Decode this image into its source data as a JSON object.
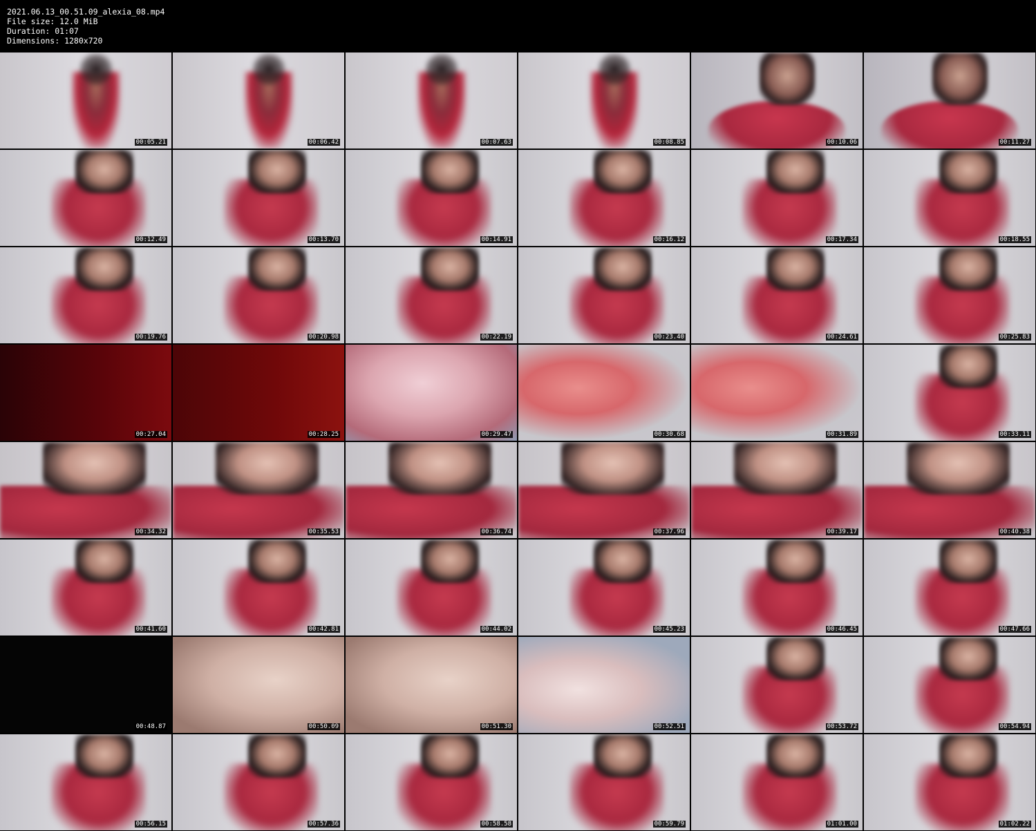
{
  "header": {
    "filename": "2021.06.13_00.51.09_alexia_08.mp4",
    "file_size": "File size: 12.0 MiB",
    "duration": "Duration: 01:07",
    "dimensions": "Dimensions: 1280x720"
  },
  "thumbnails": [
    {
      "time": "00:05.21",
      "scene": "s-wall s-person"
    },
    {
      "time": "00:06.42",
      "scene": "s-wall s-person"
    },
    {
      "time": "00:07.63",
      "scene": "s-wall s-person"
    },
    {
      "time": "00:08.85",
      "scene": "s-wall s-person"
    },
    {
      "time": "00:10.06",
      "scene": "s-close"
    },
    {
      "time": "00:11.27",
      "scene": "s-close"
    },
    {
      "time": "00:12.49",
      "scene": "s-room"
    },
    {
      "time": "00:13.70",
      "scene": "s-room"
    },
    {
      "time": "00:14.91",
      "scene": "s-room"
    },
    {
      "time": "00:16.12",
      "scene": "s-room"
    },
    {
      "time": "00:17.34",
      "scene": "s-room"
    },
    {
      "time": "00:18.55",
      "scene": "s-room"
    },
    {
      "time": "00:19.76",
      "scene": "s-room"
    },
    {
      "time": "00:20.98",
      "scene": "s-room"
    },
    {
      "time": "00:22.19",
      "scene": "s-room"
    },
    {
      "time": "00:23.40",
      "scene": "s-room"
    },
    {
      "time": "00:24.61",
      "scene": "s-room"
    },
    {
      "time": "00:25.83",
      "scene": "s-room"
    },
    {
      "time": "00:27.04",
      "scene": "s-red1"
    },
    {
      "time": "00:28.25",
      "scene": "s-red2"
    },
    {
      "time": "00:29.47",
      "scene": "s-finger"
    },
    {
      "time": "00:30.68",
      "scene": "s-finger2"
    },
    {
      "time": "00:31.89",
      "scene": "s-finger2"
    },
    {
      "time": "00:33.11",
      "scene": "s-room"
    },
    {
      "time": "00:34.32",
      "scene": "s-lips"
    },
    {
      "time": "00:35.53",
      "scene": "s-lips"
    },
    {
      "time": "00:36.74",
      "scene": "s-lips"
    },
    {
      "time": "00:37.96",
      "scene": "s-lips"
    },
    {
      "time": "00:39.17",
      "scene": "s-lips"
    },
    {
      "time": "00:40.38",
      "scene": "s-lips"
    },
    {
      "time": "00:41.60",
      "scene": "s-room"
    },
    {
      "time": "00:42.81",
      "scene": "s-room"
    },
    {
      "time": "00:44.02",
      "scene": "s-room"
    },
    {
      "time": "00:45.23",
      "scene": "s-room"
    },
    {
      "time": "00:46.45",
      "scene": "s-room"
    },
    {
      "time": "00:47.66",
      "scene": "s-room"
    },
    {
      "time": "00:48.87",
      "scene": "s-black"
    },
    {
      "time": "00:50.09",
      "scene": "s-skin"
    },
    {
      "time": "00:51.30",
      "scene": "s-skin"
    },
    {
      "time": "00:52.51",
      "scene": "s-hand"
    },
    {
      "time": "00:53.72",
      "scene": "s-room"
    },
    {
      "time": "00:54.94",
      "scene": "s-room"
    },
    {
      "time": "00:56.15",
      "scene": "s-room"
    },
    {
      "time": "00:57.36",
      "scene": "s-room"
    },
    {
      "time": "00:58.58",
      "scene": "s-room"
    },
    {
      "time": "00:59.79",
      "scene": "s-room"
    },
    {
      "time": "01:01.00",
      "scene": "s-room"
    },
    {
      "time": "01:02.22",
      "scene": "s-room"
    }
  ]
}
